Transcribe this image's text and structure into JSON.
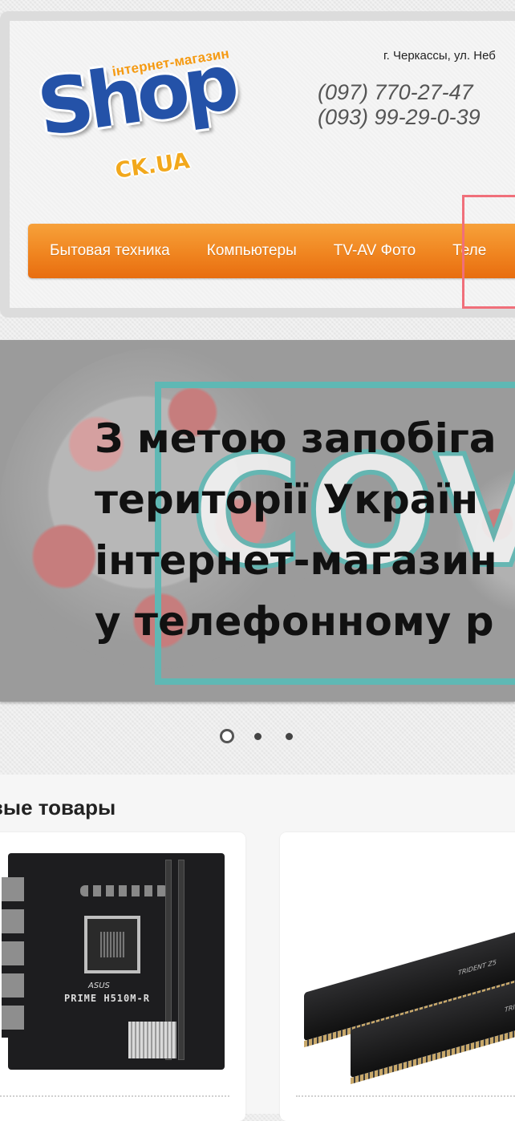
{
  "header": {
    "logo": {
      "tagline": "інтернет-магазин",
      "word": "Shop",
      "domain": "CK.UA"
    },
    "address": "г. Черкассы, ул. Неб",
    "phones": [
      "(097) 770-27-47",
      "(093) 99-29-0-39"
    ]
  },
  "nav": {
    "items": [
      {
        "label": "Бытовая техника"
      },
      {
        "label": "Компьютеры"
      },
      {
        "label": "TV-AV Фото"
      },
      {
        "label": "Теле"
      }
    ],
    "accent_color": "#f08520"
  },
  "banner": {
    "lines": [
      "З метою запобіга",
      "території Україн",
      "інтернет-магазин",
      "у телефонному р"
    ],
    "background_word": "COV",
    "frame_color": "#5fb8b4",
    "slide_count": 3,
    "active_slide": 1
  },
  "products": {
    "title": "овые товары",
    "items": [
      {
        "image": "motherboard",
        "image_text": "PRIME H510M-R",
        "image_brand": "ASUS"
      },
      {
        "image": "ram-modules",
        "image_text": "TRIDENT Z5"
      }
    ]
  }
}
